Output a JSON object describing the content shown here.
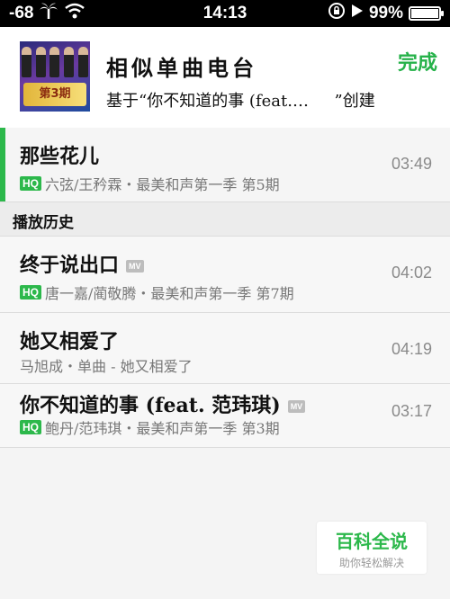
{
  "status_bar": {
    "signal": "-68",
    "time": "14:13",
    "battery": "99%",
    "battery_level": 0.99
  },
  "header": {
    "title": "相似单曲电台",
    "subtitle": "基于“你不知道的事 (feat.…     ”创建",
    "done_label": "完成",
    "album_art_text": "第3期"
  },
  "now_playing": {
    "title": "那些花儿",
    "artist": "六弦/王矜霖・最美和声第一季 第5期",
    "duration": "03:49",
    "hq": "HQ"
  },
  "history": {
    "label": "播放历史",
    "items": [
      {
        "title": "终于说出口",
        "mv": "MV",
        "hq": "HQ",
        "artist": "唐一嘉/蔺敬腾・最美和声第一季 第7期",
        "duration": "04:02"
      },
      {
        "title": "她又相爱了",
        "artist": "马旭成・单曲 - 她又相爱了",
        "duration": "04:19"
      },
      {
        "title": "你不知道的事 (feat. 范玮琪)",
        "mv": "MV",
        "hq": "HQ",
        "artist": "鲍丹/范玮琪・最美和声第一季 第3期",
        "duration": "03:17"
      }
    ]
  },
  "watermark": {
    "title": "百科全说",
    "subtitle": "助你轻松解决"
  }
}
